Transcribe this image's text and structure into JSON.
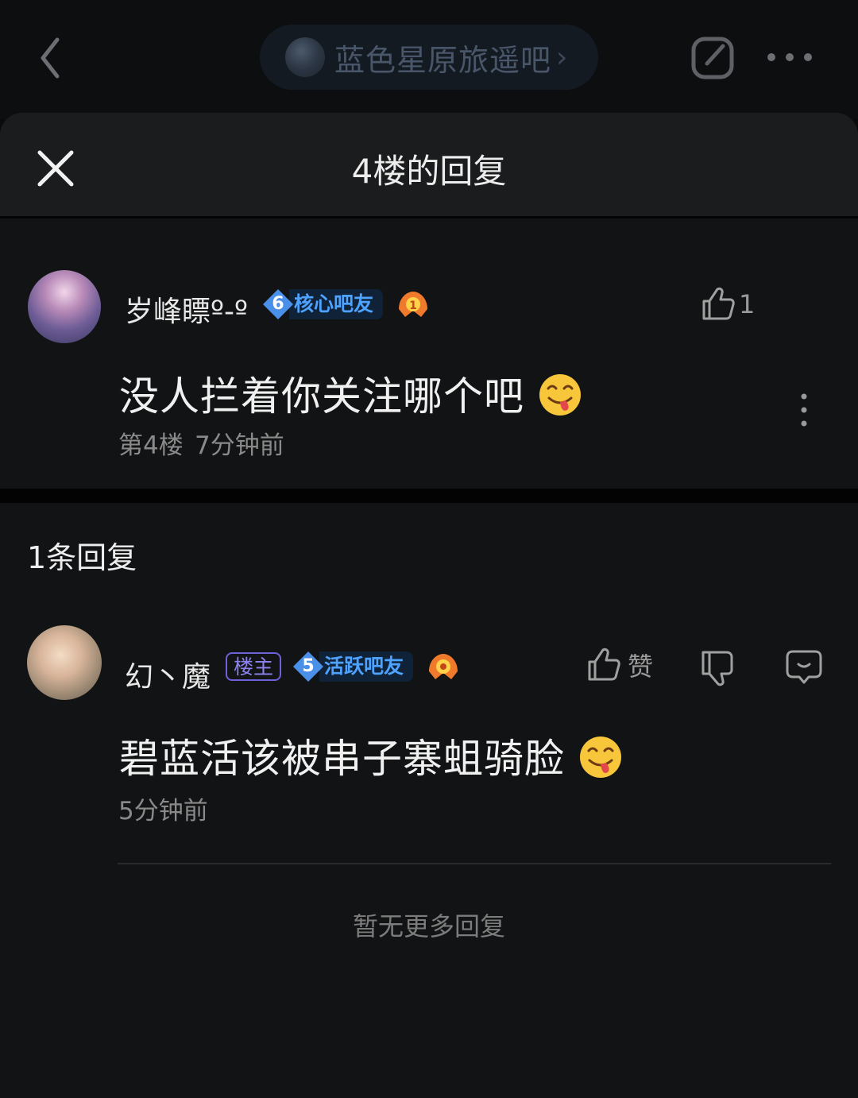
{
  "topbar": {
    "forum_name": "蓝色星原旅遥吧",
    "forum_chevron": "›"
  },
  "sheet": {
    "title": "4楼的回复"
  },
  "main_post": {
    "username": "岁峰瞟º-º",
    "level": "6",
    "level_title": "核心吧友",
    "medal_number": "1",
    "content": "没人拦着你关注哪个吧",
    "emoji": "tongue-out-emoji",
    "floor": "第4楼",
    "time": "7分钟前",
    "like_count": "1"
  },
  "replies": {
    "count_label": "1条回复",
    "items": [
      {
        "username": "幻丶魔",
        "host_tag": "楼主",
        "level": "5",
        "level_title": "活跃吧友",
        "content": "碧蓝活该被串子寨蛆骑脸",
        "emoji": "tongue-out-emoji",
        "time": "5分钟前",
        "like_label": "赞"
      }
    ],
    "no_more_label": "暂无更多回复"
  },
  "colors": {
    "sheet_background": "#121314",
    "level_blue": "#4da3ff",
    "host_tag_purple": "#8d83f0"
  }
}
